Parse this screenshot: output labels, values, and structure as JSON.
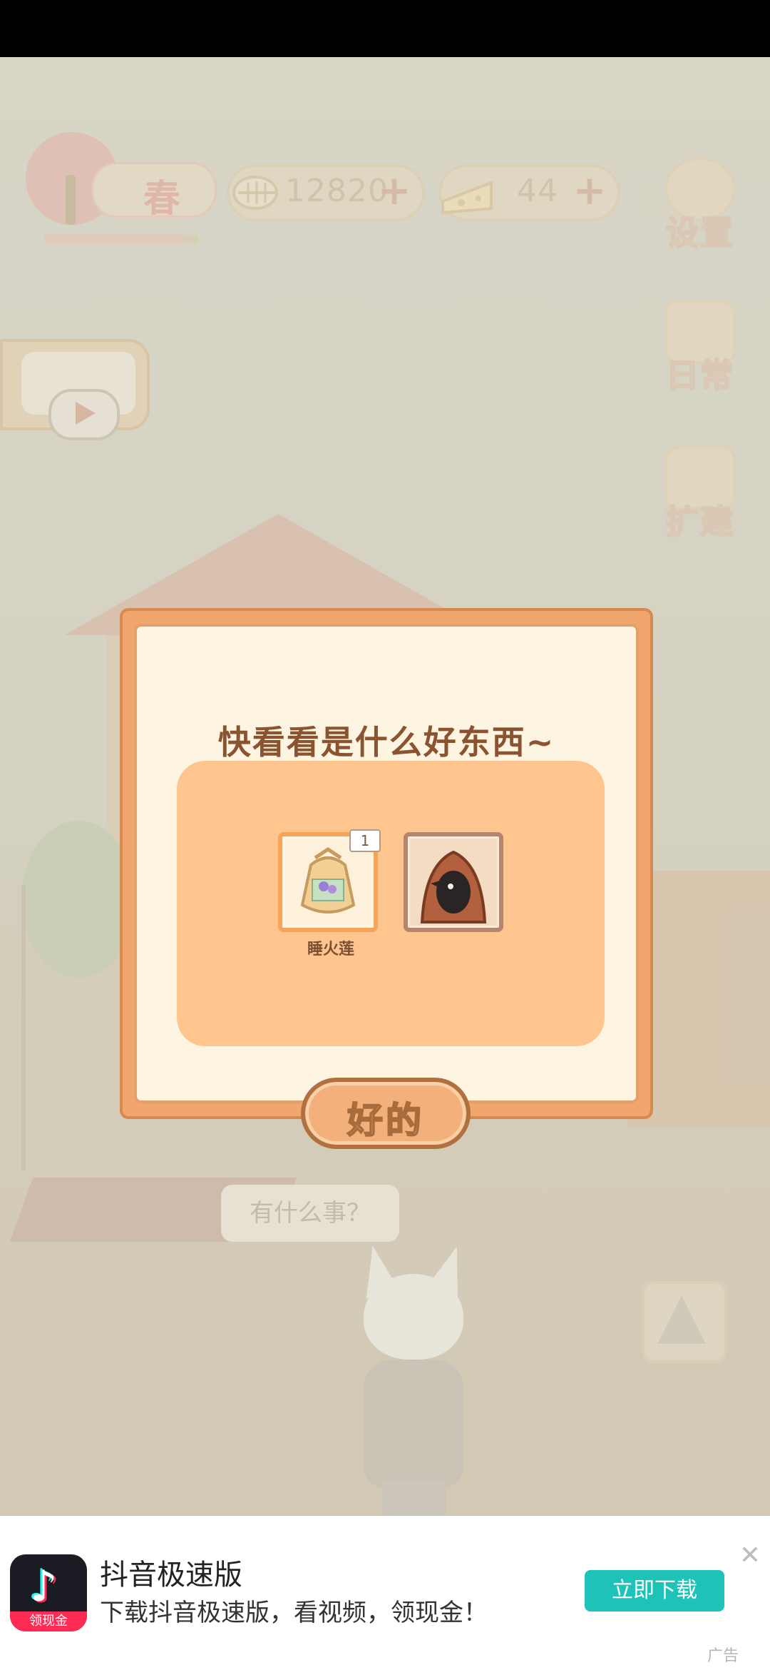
{
  "hud": {
    "season_label": "春",
    "fish_value": "12820",
    "cheese_value": "44",
    "plus_symbol": "+"
  },
  "side_menu": {
    "settings": "设置",
    "daily": "日常",
    "expand": "扩建"
  },
  "scene": {
    "speech_text": "有什么事？"
  },
  "dialog": {
    "title": "快看看是什么好东西~",
    "items": [
      {
        "name": "睡火莲",
        "count": "1",
        "icon": "seed-bag-icon"
      },
      {
        "name": "",
        "icon": "hooded-crow-icon"
      }
    ],
    "ok_label": "好的"
  },
  "ad": {
    "app_name": "抖音极速版",
    "description": "下载抖音极速版，看视频，领现金！",
    "download_label": "立即下载",
    "logo_badge": "领现金",
    "ad_tag": "广告",
    "colors": {
      "download_button": "#1fc2b8"
    }
  }
}
